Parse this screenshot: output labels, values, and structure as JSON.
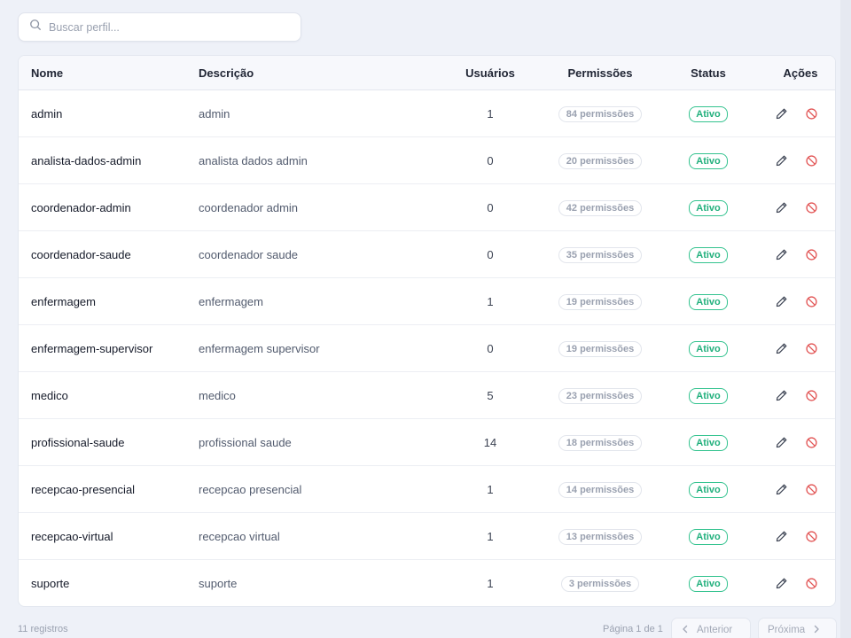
{
  "search": {
    "placeholder": "Buscar perfil..."
  },
  "table": {
    "headers": {
      "nome": "Nome",
      "descricao": "Descrição",
      "usuarios": "Usuários",
      "permissoes": "Permissões",
      "status": "Status",
      "acoes": "Ações"
    },
    "rows": [
      {
        "nome": "admin",
        "descricao": "admin",
        "usuarios": "1",
        "permissoes": "84 permissões",
        "status": "Ativo"
      },
      {
        "nome": "analista-dados-admin",
        "descricao": "analista dados admin",
        "usuarios": "0",
        "permissoes": "20 permissões",
        "status": "Ativo"
      },
      {
        "nome": "coordenador-admin",
        "descricao": "coordenador admin",
        "usuarios": "0",
        "permissoes": "42 permissões",
        "status": "Ativo"
      },
      {
        "nome": "coordenador-saude",
        "descricao": "coordenador saude",
        "usuarios": "0",
        "permissoes": "35 permissões",
        "status": "Ativo"
      },
      {
        "nome": "enfermagem",
        "descricao": "enfermagem",
        "usuarios": "1",
        "permissoes": "19 permissões",
        "status": "Ativo"
      },
      {
        "nome": "enfermagem-supervisor",
        "descricao": "enfermagem supervisor",
        "usuarios": "0",
        "permissoes": "19 permissões",
        "status": "Ativo"
      },
      {
        "nome": "medico",
        "descricao": "medico",
        "usuarios": "5",
        "permissoes": "23 permissões",
        "status": "Ativo"
      },
      {
        "nome": "profissional-saude",
        "descricao": "profissional saude",
        "usuarios": "14",
        "permissoes": "18 permissões",
        "status": "Ativo"
      },
      {
        "nome": "recepcao-presencial",
        "descricao": "recepcao presencial",
        "usuarios": "1",
        "permissoes": "14 permissões",
        "status": "Ativo"
      },
      {
        "nome": "recepcao-virtual",
        "descricao": "recepcao virtual",
        "usuarios": "1",
        "permissoes": "13 permissões",
        "status": "Ativo"
      },
      {
        "nome": "suporte",
        "descricao": "suporte",
        "usuarios": "1",
        "permissoes": "3 permissões",
        "status": "Ativo"
      }
    ]
  },
  "footer": {
    "count": "11 registros",
    "page_info": "Página 1 de 1",
    "prev_label": "Anterior",
    "next_label": "Próxima"
  },
  "icons": {
    "search": "search-icon",
    "edit": "pencil-icon",
    "deactivate": "ban-icon",
    "prev": "chevron-left-icon",
    "next": "chevron-right-icon"
  },
  "colors": {
    "status_active": "#22b07d",
    "deactivate": "#e25555",
    "edit": "#3b4252"
  }
}
